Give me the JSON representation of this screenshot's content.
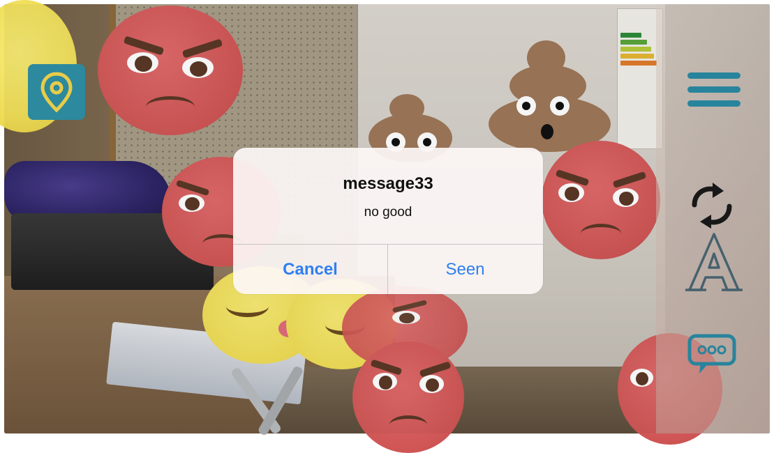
{
  "dialog": {
    "title": "message33",
    "message": "no good",
    "cancel_label": "Cancel",
    "confirm_label": "Seen"
  },
  "controls": {
    "location_icon": "map-pin-icon",
    "menu_icon": "hamburger-menu-icon",
    "refresh_icon": "refresh-arrows-icon",
    "font_icon": "font-letter-a-icon",
    "chat_icon": "chat-bubble-icon"
  },
  "scene": {
    "decorations": [
      "angry-emoji",
      "smiling-emoji",
      "poop-emoji",
      "fork-and-knife"
    ]
  },
  "colors": {
    "accent": "#2a8aa3",
    "dialog_button": "#2f7ff0",
    "angry_emoji": "#d05656"
  }
}
